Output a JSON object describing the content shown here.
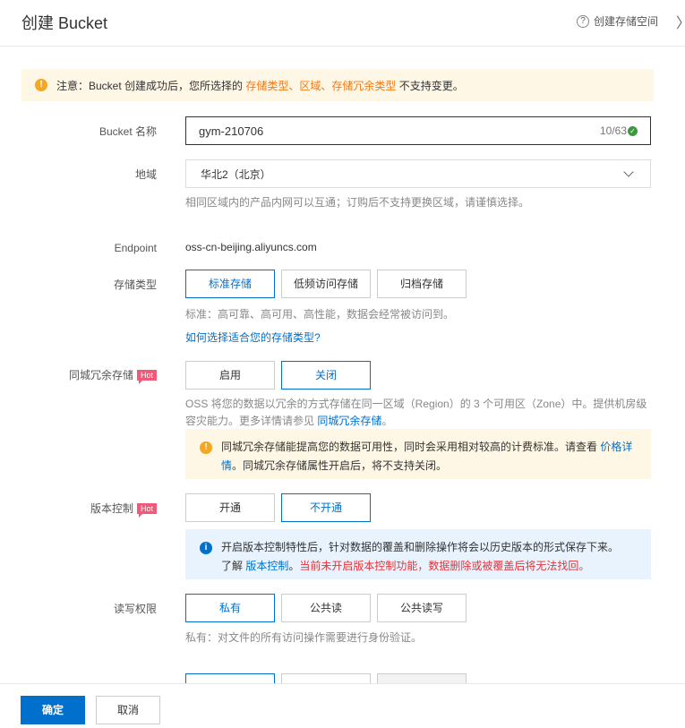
{
  "header": {
    "title": "创建 Bucket",
    "help_label": "创建存储空间",
    "close_glyph": "〉"
  },
  "notice": {
    "prefix": "注意：Bucket 创建成功后，您所选择的 ",
    "highlight": "存储类型、区域、存储冗余类型",
    "suffix": " 不支持变更。"
  },
  "bucket_name": {
    "label": "Bucket 名称",
    "value": "gym-210706",
    "counter": "10/63"
  },
  "region": {
    "label": "地域",
    "selected": "华北2（北京）",
    "hint": "相同区域内的产品内网可以互通；订购后不支持更换区域，请谨慎选择。"
  },
  "endpoint": {
    "label": "Endpoint",
    "value": "oss-cn-beijing.aliyuncs.com"
  },
  "storage_class": {
    "label": "存储类型",
    "options": [
      "标准存储",
      "低频访问存储",
      "归档存储"
    ],
    "selected": "标准存储",
    "hint": "标准：高可靠、高可用、高性能，数据会经常被访问到。",
    "help_link": "如何选择适合您的存储类型?"
  },
  "redundancy": {
    "label": "同城冗余存储",
    "badge": "Hot",
    "options": [
      "启用",
      "关闭"
    ],
    "selected": "关闭",
    "hint_text": "OSS 将您的数据以冗余的方式存储在同一区域（Region）的 3 个可用区（Zone）中。提供机房级容灾能力。更多详情请参见 ",
    "hint_link": "同城冗余存储",
    "hint_end": "。",
    "tip_text": "同城冗余存储能提高您的数据可用性，同时会采用相对较高的计费标准。请查看 ",
    "tip_link": "价格详情",
    "tip_end": "。同城冗余存储属性开启后，将不支持关闭。"
  },
  "versioning": {
    "label": "版本控制",
    "badge": "Hot",
    "options": [
      "开通",
      "不开通"
    ],
    "selected": "不开通",
    "tip_line1": "开启版本控制特性后，针对数据的覆盖和删除操作将会以历史版本的形式保存下来。",
    "tip_prefix": "了解 ",
    "tip_link": "版本控制",
    "tip_sep": "。",
    "tip_warning": "当前未开启版本控制功能，数据删除或被覆盖后将无法找回。"
  },
  "acl": {
    "label": "读写权限",
    "options": [
      "私有",
      "公共读",
      "公共读写"
    ],
    "selected": "私有",
    "hint": "私有：对文件的所有访问操作需要进行身份验证。"
  },
  "footer": {
    "confirm": "确定",
    "cancel": "取消"
  },
  "colors": {
    "accent": "#0070cc",
    "warning": "#f07a17",
    "hot": "#f05a78",
    "danger": "#e0353b"
  }
}
